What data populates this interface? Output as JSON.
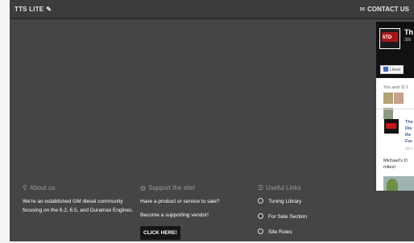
{
  "topbar": {
    "brand": "TTS LITE",
    "contact": "CONTACT US"
  },
  "icons": {
    "brand": "pencil-icon",
    "contact": "envelope-icon",
    "about": "map-marker-icon",
    "support": "globe-icon",
    "links": "list-icon",
    "link_bullet": "circle-arrow-icon"
  },
  "footer": {
    "about": {
      "heading": "About us",
      "text": "We're an established GM diesel community focusing on the 6.2, 6.5, and Duramax Engines."
    },
    "support": {
      "heading": "Support the site!",
      "question": "Have a product or service to sale?",
      "vendor": "Become a supporting vendor!",
      "button": "CLICK HERE!"
    },
    "links": {
      "heading": "Useful Links",
      "items": [
        "Tuning Library",
        "For Sale Section",
        "Site Rules"
      ]
    }
  },
  "facebook": {
    "page_name": "Th",
    "page_sub": "305",
    "logo_text": "5TD",
    "liked": "Liked",
    "friends": "You and 11 f",
    "post_title": "The\nDie\nRe\nFor",
    "post_time": "10 s",
    "post_text": "Michael's D\nmiles!"
  },
  "colors": {
    "topbar": "#3c3c3c",
    "main_background": "#454545",
    "heading_gray": "#9a9a9a",
    "button_dark": "#161616",
    "facebook_blue": "#365899"
  }
}
